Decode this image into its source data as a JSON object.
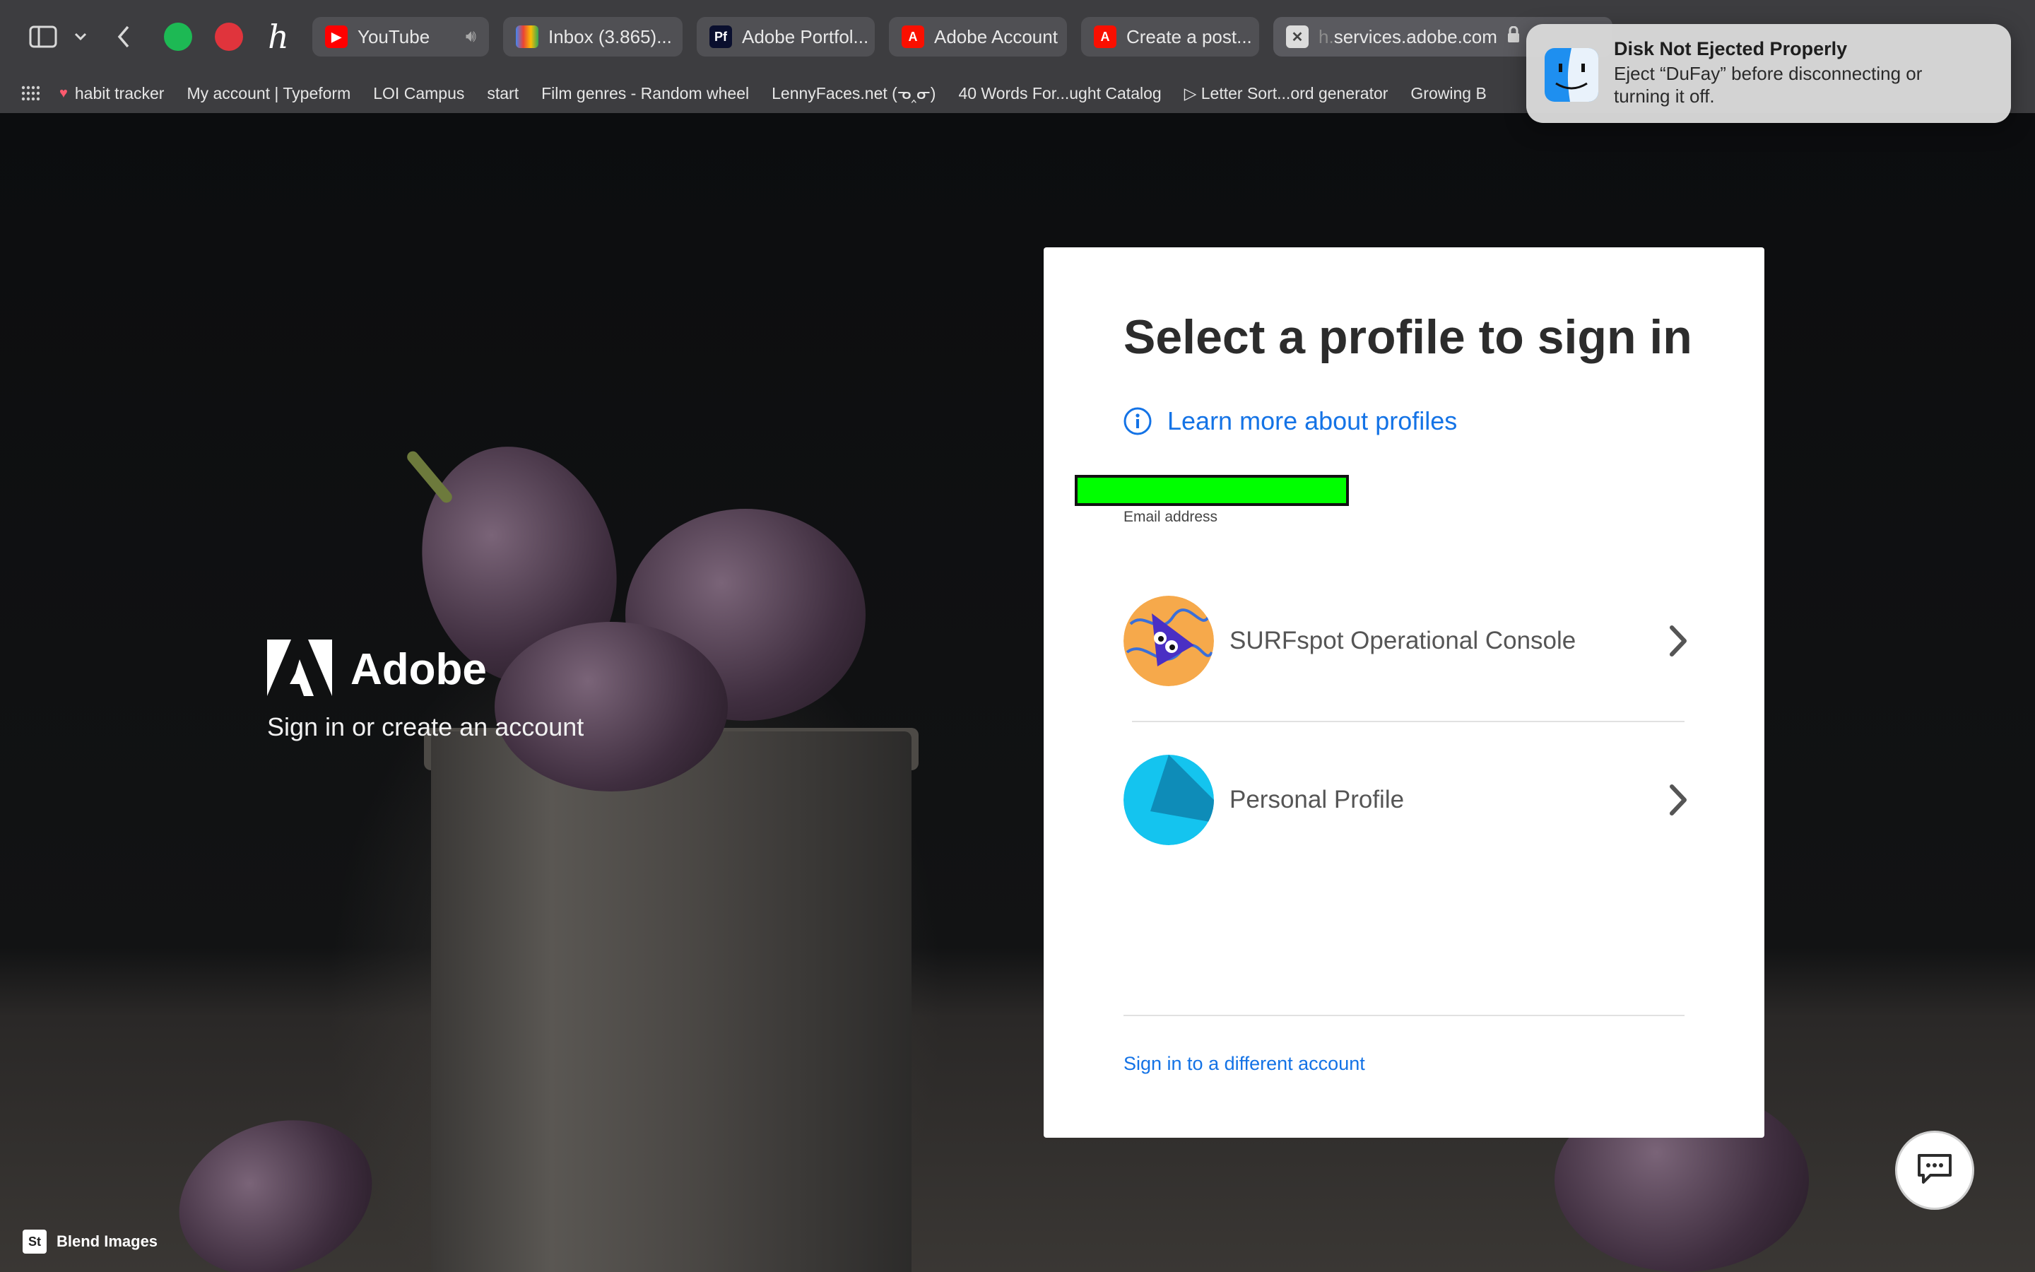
{
  "browser": {
    "tabs": [
      {
        "label": "YouTube",
        "icon": "youtube-icon",
        "audio": true
      },
      {
        "label": "Inbox (3.865)...",
        "icon": "gmail-icon"
      },
      {
        "label": "Adobe Portfol...",
        "icon": "adobe-portfolio-icon"
      },
      {
        "label": "Adobe Account",
        "icon": "adobe-icon"
      },
      {
        "label": "Create a post...",
        "icon": "adobe-icon"
      },
      {
        "label_prefix": "h.",
        "label": "services.adobe.com",
        "icon": "close-icon",
        "active": true
      }
    ],
    "bookmarks": [
      {
        "label": "habit tracker",
        "icon": "heart-icon"
      },
      {
        "label": "My account | Typeform"
      },
      {
        "label": "LOI Campus"
      },
      {
        "label": "start"
      },
      {
        "label": "Film genres - Random wheel"
      },
      {
        "label": "LennyFaces.net (ᓀ‸ᓂ)"
      },
      {
        "label": "40 Words For...ught Catalog"
      },
      {
        "label": "▷ Letter Sort...ord generator"
      },
      {
        "label": "Growing B"
      }
    ]
  },
  "brand": {
    "wordmark": "Adobe",
    "tagline": "Sign in or create an account"
  },
  "card": {
    "title": "Select a profile to sign in",
    "learn_more": "Learn more about profiles",
    "email_label": "Email address",
    "profiles": [
      {
        "name": "SURFspot Operational Console"
      },
      {
        "name": "Personal Profile"
      }
    ],
    "different_account": "Sign in to a different account"
  },
  "stock_credit": {
    "badge": "St",
    "label": "Blend Images"
  },
  "notification": {
    "title": "Disk Not Ejected Properly",
    "body": "Eject “DuFay” before disconnecting or turning it off."
  },
  "colors": {
    "link": "#1473e6",
    "redaction": "#00ff00",
    "adobe_red": "#fa0f00"
  }
}
